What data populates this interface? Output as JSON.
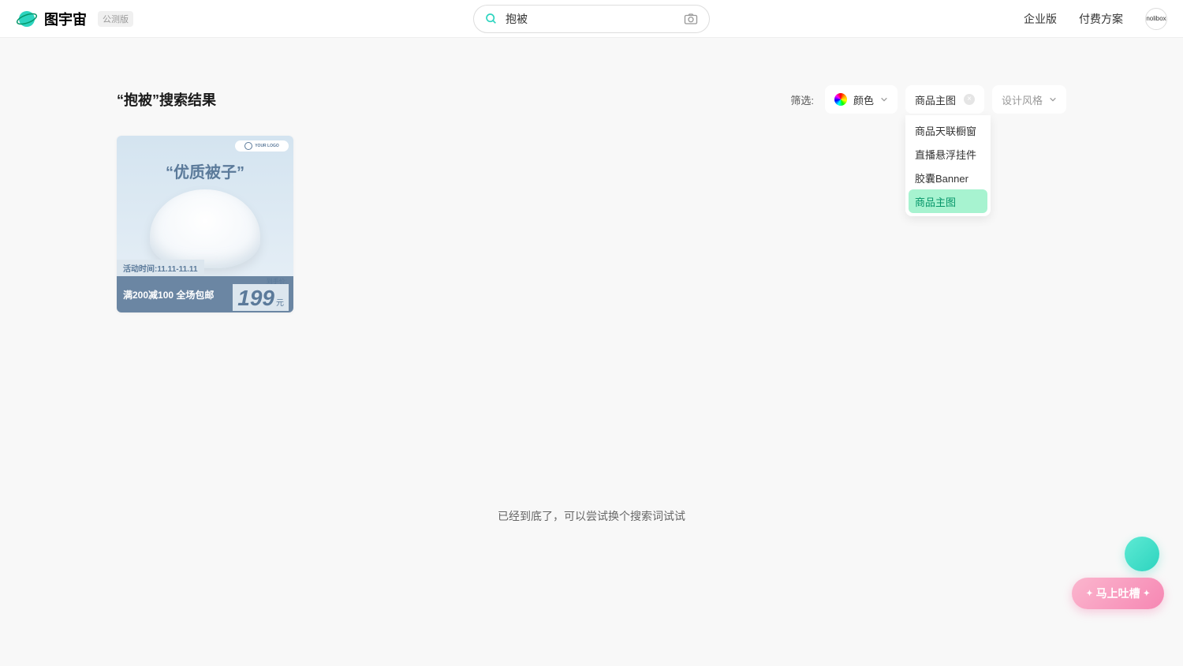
{
  "header": {
    "logo_text": "图宇宙",
    "logo_badge": "公测版",
    "search_value": "抱被",
    "links": [
      "企业版",
      "付费方案"
    ],
    "avatar_text": "nolibox"
  },
  "page": {
    "title": "“抱被”搜索结果",
    "filter_label": "筛选:",
    "filters": {
      "color": {
        "label": "颜色"
      },
      "type": {
        "selected": "商品主图"
      },
      "style": {
        "label": "设计风格"
      }
    },
    "dropdown_items": [
      "商品天联橱窗",
      "直播悬浮挂件",
      "胶囊Banner",
      "商品主图"
    ],
    "dropdown_selected_index": 3
  },
  "card": {
    "logo_text": "YOUR LOGO",
    "title": "“优质被子”",
    "time_text": "活动时间:11.11-11.11",
    "deal_text": "满200减100 全场包邮",
    "price_label": "到手价:",
    "price": "199",
    "price_unit": "元"
  },
  "end_text": "已经到底了，可以尝试换个搜索词试试",
  "feedback_label": "马上吐槽"
}
